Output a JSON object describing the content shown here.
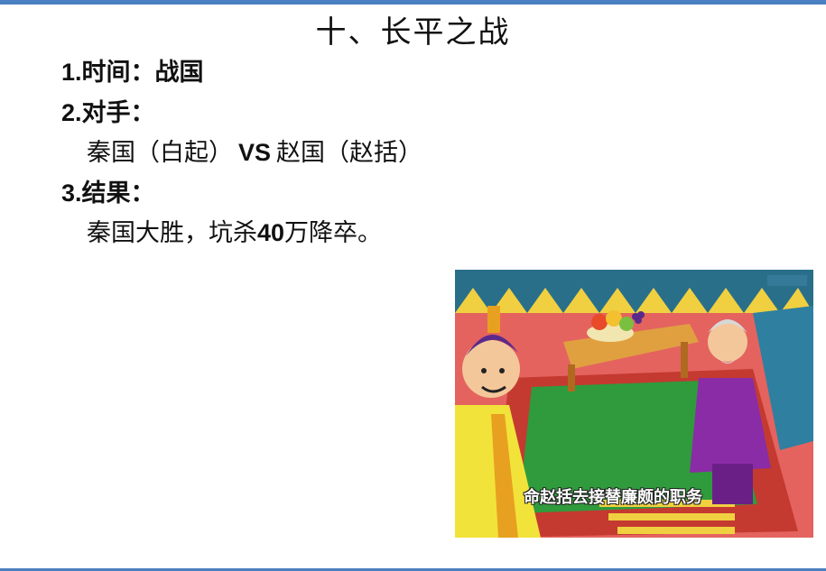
{
  "slide": {
    "title": "十、长平之战",
    "items": [
      {
        "num": "1.",
        "label": "时间：",
        "value": "战国"
      },
      {
        "num": "2.",
        "label": "对手："
      },
      {
        "num": "3.",
        "label": "结果："
      }
    ],
    "opponents": {
      "side_a": "秦国（白起）",
      "vs": "VS",
      "side_b": "赵国（赵括）"
    },
    "result_text": "秦国大胜，坑杀",
    "result_number": "40",
    "result_tail": "万降卒。"
  },
  "image": {
    "subtitle": "命赵括去接替廉颇的职务"
  },
  "colors": {
    "accent_bar": "#4a7fc1",
    "background_red": "#e4635f",
    "carpet_green": "#2f9b3c",
    "robe_yellow": "#f2e33a",
    "robe_purple": "#8a2ca6"
  }
}
